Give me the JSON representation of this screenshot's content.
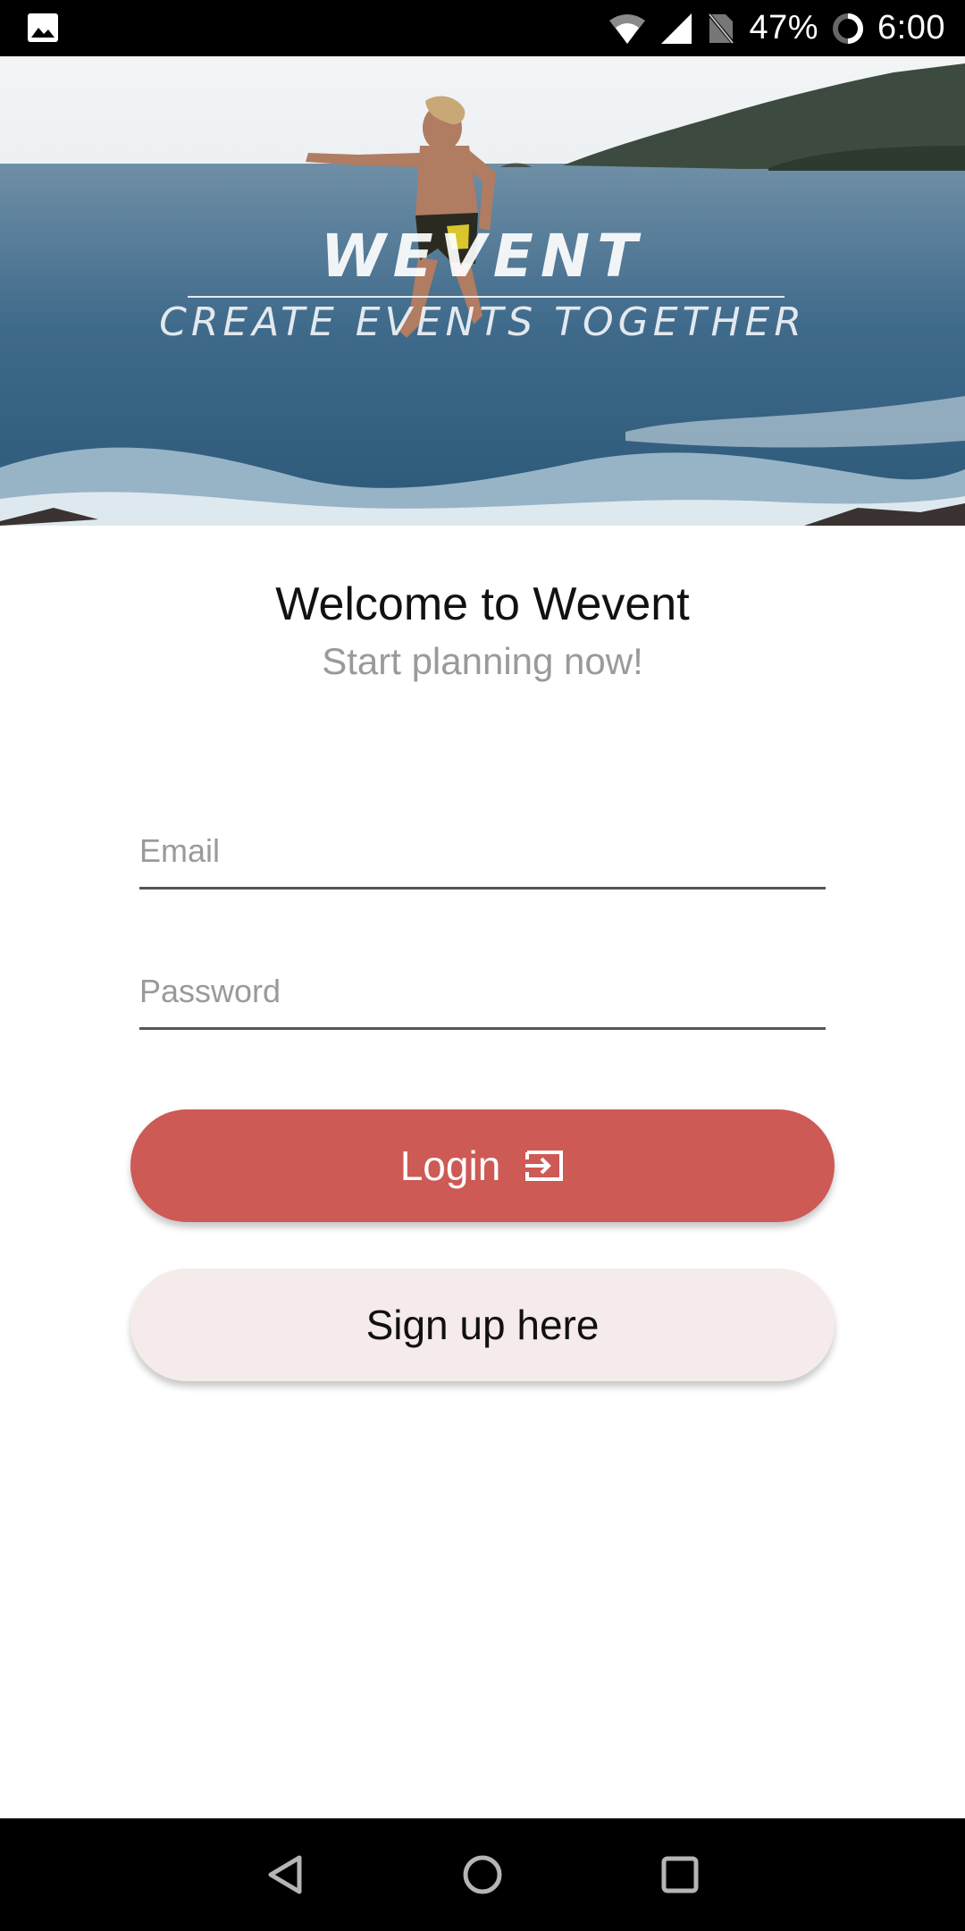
{
  "status_bar": {
    "battery": "47%",
    "time": "6:00",
    "icons": [
      "gallery-icon",
      "wifi-icon",
      "cell-signal-icon",
      "no-sim-icon",
      "battery-icon"
    ]
  },
  "hero": {
    "brand": "WEVENT",
    "tagline": "CREATE EVENTS TOGETHER",
    "image": "person-jumping-into-ocean"
  },
  "welcome": {
    "title": "Welcome to Wevent",
    "subtitle": "Start planning now!"
  },
  "form": {
    "email_placeholder": "Email",
    "email_value": "",
    "password_placeholder": "Password",
    "password_value": ""
  },
  "buttons": {
    "login_label": "Login",
    "login_icon": "login-icon",
    "signup_label": "Sign up here"
  },
  "colors": {
    "primary": "#cd5a55",
    "secondary": "#f5ebea"
  },
  "nav_bar": {
    "icons": [
      "back-icon",
      "home-icon",
      "recents-icon"
    ]
  }
}
